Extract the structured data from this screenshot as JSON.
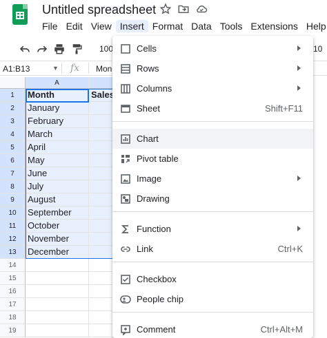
{
  "window": {
    "doc_title": "Untitled spreadsheet"
  },
  "menubar": {
    "items": [
      "File",
      "Edit",
      "View",
      "Insert",
      "Format",
      "Data",
      "Tools",
      "Extensions",
      "Help"
    ],
    "active": "Insert"
  },
  "toolbar": {
    "zoom": "100",
    "right_text": "10"
  },
  "formula_bar": {
    "name_box": "A1:B13",
    "fx_label": "fx",
    "content": "Mon"
  },
  "grid": {
    "columns": [
      "A"
    ],
    "rows": [
      "1",
      "2",
      "3",
      "4",
      "5",
      "6",
      "7",
      "8",
      "9",
      "10",
      "11",
      "12",
      "13",
      "14",
      "15",
      "16",
      "17",
      "18",
      "19"
    ],
    "col_a": [
      "Month",
      "January",
      "February",
      "March",
      "April",
      "May",
      "June",
      "July",
      "August",
      "September",
      "October",
      "November",
      "December"
    ],
    "col_b_header": "Sales"
  },
  "insert_menu": {
    "items": [
      {
        "label": "Cells",
        "icon": "cells-icon",
        "submenu": true,
        "shortcut": ""
      },
      {
        "label": "Rows",
        "icon": "rows-icon",
        "submenu": true,
        "shortcut": ""
      },
      {
        "label": "Columns",
        "icon": "columns-icon",
        "submenu": true,
        "shortcut": ""
      },
      {
        "label": "Sheet",
        "icon": "sheet-icon",
        "submenu": false,
        "shortcut": "Shift+F11"
      },
      {
        "label": "Chart",
        "icon": "chart-icon",
        "submenu": false,
        "shortcut": ""
      },
      {
        "label": "Pivot table",
        "icon": "pivot-table-icon",
        "submenu": false,
        "shortcut": ""
      },
      {
        "label": "Image",
        "icon": "image-icon",
        "submenu": true,
        "shortcut": ""
      },
      {
        "label": "Drawing",
        "icon": "drawing-icon",
        "submenu": false,
        "shortcut": ""
      },
      {
        "label": "Function",
        "icon": "sigma-icon",
        "submenu": true,
        "shortcut": ""
      },
      {
        "label": "Link",
        "icon": "link-icon",
        "submenu": false,
        "shortcut": "Ctrl+K"
      },
      {
        "label": "Checkbox",
        "icon": "checkbox-icon",
        "submenu": false,
        "shortcut": ""
      },
      {
        "label": "People chip",
        "icon": "people-chip-icon",
        "submenu": false,
        "shortcut": ""
      },
      {
        "label": "Comment",
        "icon": "comment-icon",
        "submenu": false,
        "shortcut": "Ctrl+Alt+M"
      }
    ],
    "hovered": "Chart"
  },
  "colors": {
    "brand": "#0f9d58",
    "selection": "#1a73e8",
    "selection_fill": "#e8f0fe",
    "menu_hover": "#f1f3f4"
  }
}
